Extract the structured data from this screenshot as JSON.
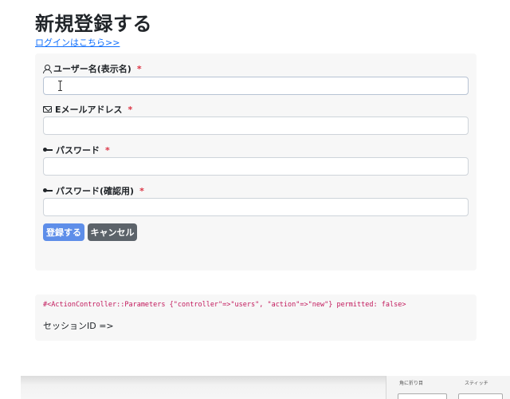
{
  "header": {
    "title": "新規登録する",
    "login_link": "ログインはこちら>>"
  },
  "form": {
    "fields": [
      {
        "label": "ユーザー名(表示名)",
        "required": "*",
        "icon": "user-icon",
        "value": ""
      },
      {
        "label": "Eメールアドレス",
        "required": "*",
        "icon": "mail-icon",
        "value": ""
      },
      {
        "label": "パスワード",
        "required": "*",
        "icon": "key-icon",
        "value": ""
      },
      {
        "label": "パスワード(確認用)",
        "required": "*",
        "icon": "key-icon",
        "value": ""
      }
    ],
    "submit_label": "登録する",
    "cancel_label": "キャンセル",
    "colors": {
      "primary": "#5e8ee9",
      "secondary": "#5c636a",
      "required": "#dc3545"
    }
  },
  "debug": {
    "params": "#<ActionController::Parameters {\"controller\"=>\"users\", \"action\"=>\"new\"} permitted: false>",
    "session": "セッションID =>"
  },
  "bottom_panel": {
    "label_a": "角に折り目",
    "label_b": "スティッチ"
  }
}
